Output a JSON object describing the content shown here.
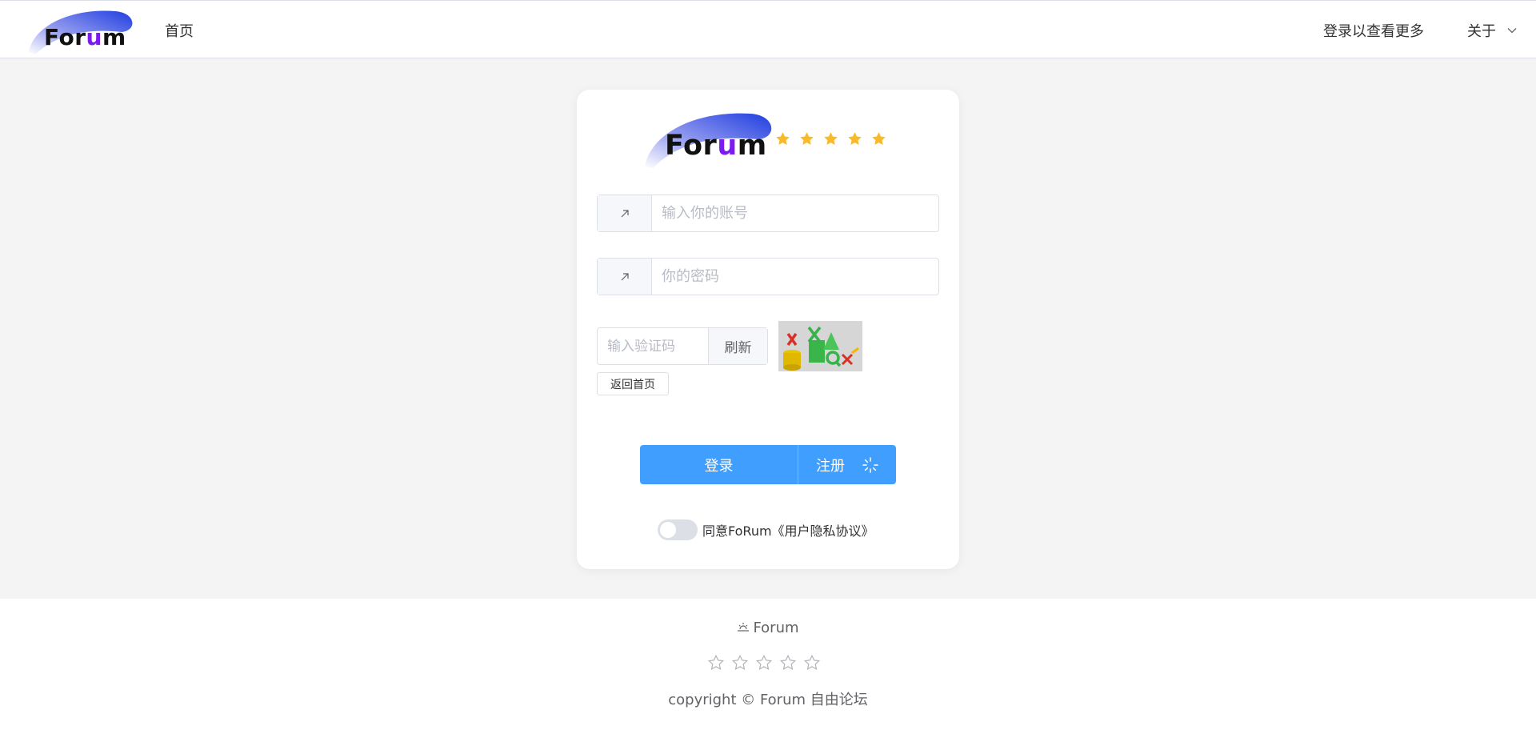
{
  "header": {
    "logo_text_pre": "Fo",
    "logo_text_r": "r",
    "logo_text_u": "u",
    "logo_text_post": "m",
    "nav_home": "首页",
    "nav_login_more": "登录以查看更多",
    "nav_about": "关于"
  },
  "login_card": {
    "logo_text_pre": "Fo",
    "logo_text_r": "r",
    "logo_text_u": "u",
    "logo_text_post": "m",
    "rating_stars": 5,
    "account_placeholder": "输入你的账号",
    "password_placeholder": "你的密码",
    "captcha_placeholder": "输入验证码",
    "refresh_label": "刷新",
    "back_home_label": "返回首页",
    "login_label": "登录",
    "register_label": "注册",
    "agree_text": "同意FoRum《用户隐私协议》",
    "agree_checked": false
  },
  "footer": {
    "brand": "Forum",
    "rating_stars": 0,
    "copyright": "copyright © Forum 自由论坛"
  },
  "colors": {
    "primary": "#409eff",
    "star_gold": "#f7ba2a",
    "logo_purple": "#7a1cf0",
    "logo_blue": "#1f3ee0"
  }
}
